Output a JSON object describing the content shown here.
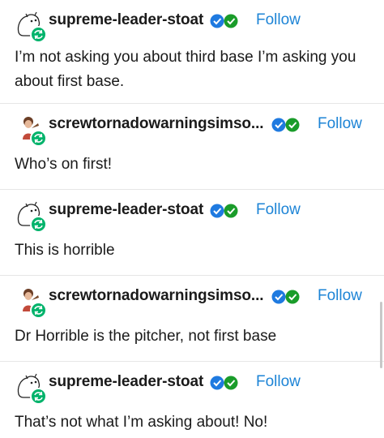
{
  "follow_label": "Follow",
  "colors": {
    "accent": "#1d84d6",
    "verified_blue": "#1f7ae0",
    "verified_green": "#1a9c2a",
    "reblog_green": "#00b36b"
  },
  "posts": [
    {
      "username": "supreme-leader-stoat",
      "avatar": "stoat-avatar",
      "text": "I’m not asking you about third base I’m asking you about first base."
    },
    {
      "username": "screwtornadowarningsimso...",
      "avatar": "person-avatar",
      "text": "Who’s on first!"
    },
    {
      "username": "supreme-leader-stoat",
      "avatar": "stoat-avatar",
      "text": "This is horrible"
    },
    {
      "username": "screwtornadowarningsimso...",
      "avatar": "person-avatar",
      "text": "Dr Horrible is the pitcher, not first base"
    },
    {
      "username": "supreme-leader-stoat",
      "avatar": "stoat-avatar",
      "text": "That’s not what I’m asking about! No!"
    }
  ]
}
